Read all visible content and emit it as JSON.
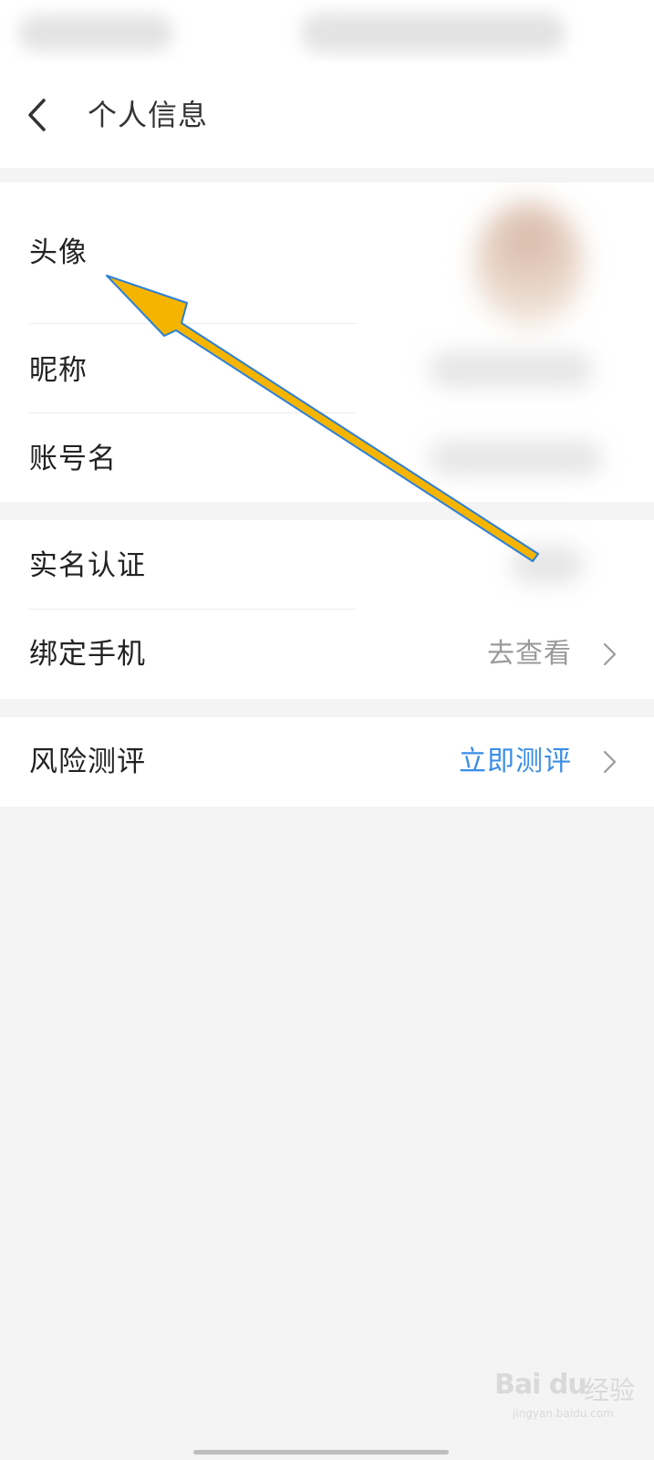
{
  "header": {
    "title": "个人信息"
  },
  "groups": [
    {
      "rows": [
        {
          "label": "头像",
          "value": ""
        },
        {
          "label": "昵称",
          "value": ""
        },
        {
          "label": "账号名",
          "value": ""
        }
      ]
    },
    {
      "rows": [
        {
          "label": "实名认证",
          "value": ""
        },
        {
          "label": "绑定手机",
          "value": "去查看"
        }
      ]
    },
    {
      "rows": [
        {
          "label": "风险测评",
          "value": "立即测评"
        }
      ]
    }
  ],
  "colors": {
    "link": "#3a8ee6",
    "muted": "#9a9a9a",
    "annotation_arrow": "#f5b400",
    "annotation_outline": "#2b7fd6"
  },
  "icons": {
    "back": "chevron-left-icon",
    "row_arrow": "chevron-right-icon"
  },
  "watermark": {
    "logo": "Bai du",
    "text": "经验",
    "url": "jingyan.baidu.com"
  }
}
